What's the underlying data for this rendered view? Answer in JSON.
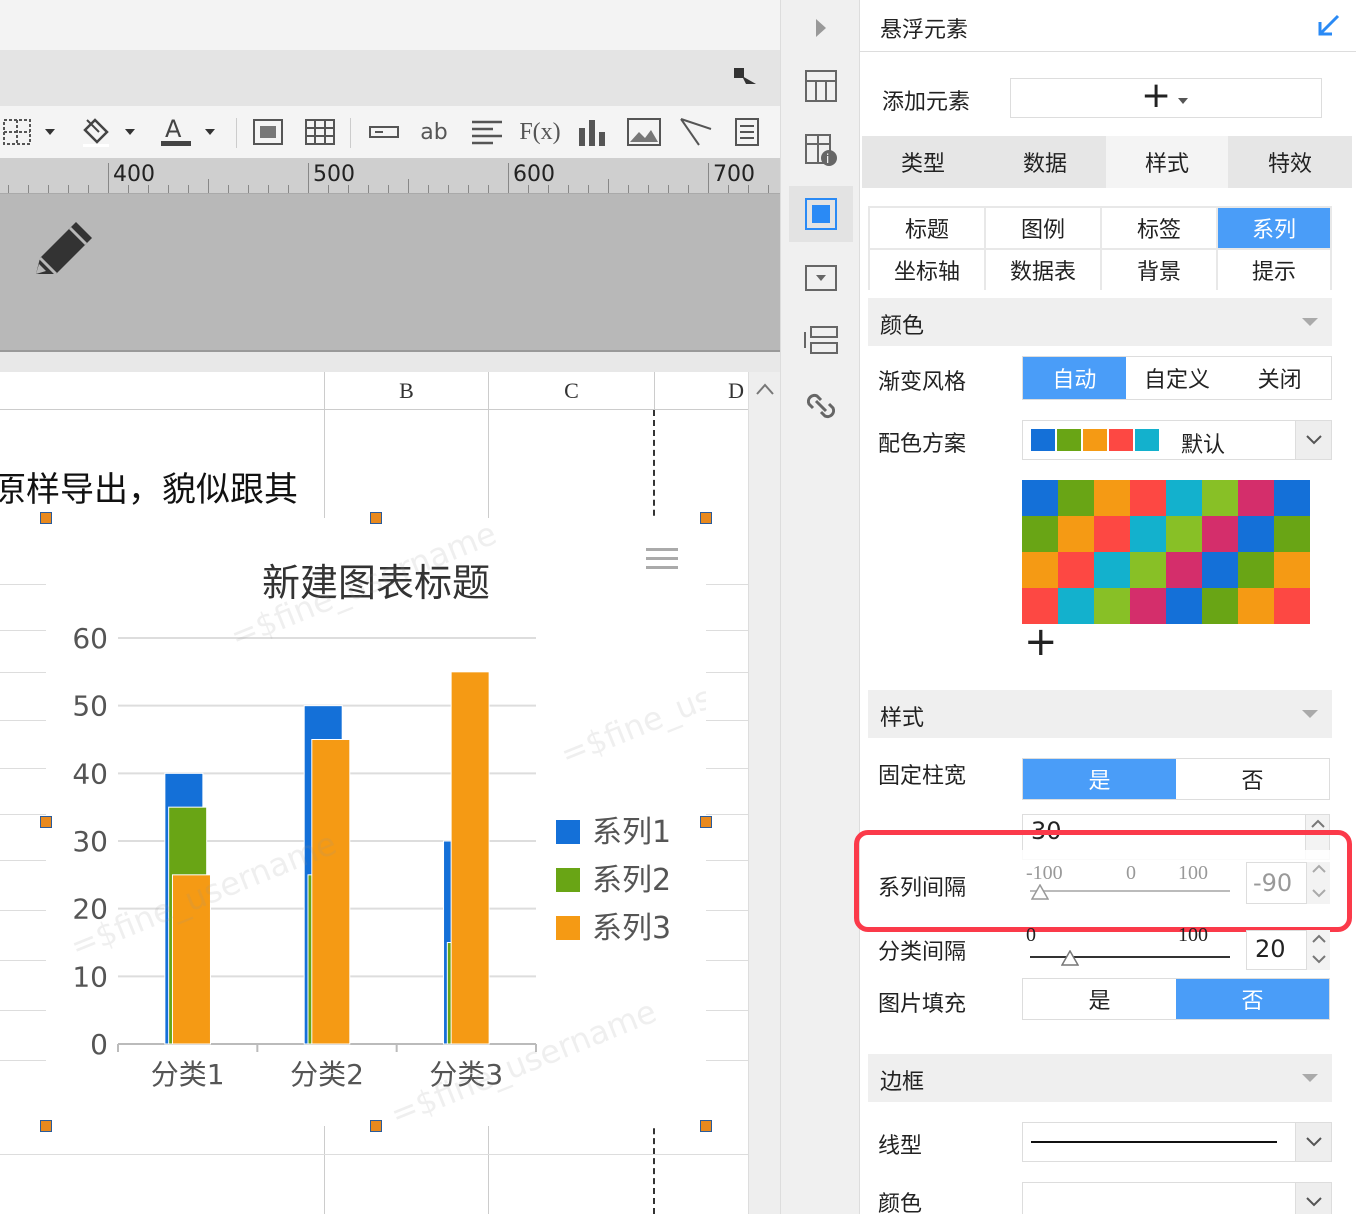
{
  "editor": {
    "toolbar_icons": [
      "border-icon",
      "paint-bucket-icon",
      "font-color-icon",
      "merge-icon",
      "table-icon",
      "textbox-icon",
      "ab-icon",
      "align-icon",
      "formula-icon",
      "bar-chart-icon",
      "image-icon",
      "slash-icon",
      "page-icon"
    ],
    "ruler": {
      "labels": [
        "400",
        "500",
        "600",
        "700"
      ]
    },
    "columns": [
      "B",
      "C",
      "D"
    ],
    "cell_text": "原样导出，貌似跟其"
  },
  "chart": {
    "chart_data": {
      "type": "bar",
      "title": "新建图表标题",
      "categories": [
        "分类1",
        "分类2",
        "分类3"
      ],
      "series": [
        {
          "name": "系列1",
          "values": [
            40,
            50,
            30
          ]
        },
        {
          "name": "系列2",
          "values": [
            35,
            25,
            15
          ]
        },
        {
          "name": "系列3",
          "values": [
            25,
            45,
            55
          ]
        }
      ],
      "ylim": [
        0,
        60
      ],
      "yticks": [
        "0",
        "10",
        "20",
        "30",
        "40",
        "50",
        "60"
      ],
      "legend": "right",
      "grid": true,
      "series_gap": -90,
      "colors": [
        "#1470d8",
        "#69a515",
        "#f59a14"
      ]
    },
    "menu_icon": "hamburger-icon",
    "watermark": "=$fine_username"
  },
  "sidebar_icons": [
    "expand-arrow-icon",
    "cell-element-icon",
    "cell-attr-icon",
    "float-element-icon",
    "widget-icon",
    "condition-icon",
    "link-icon"
  ],
  "panel": {
    "title": "悬浮元素",
    "add_label": "添加元素",
    "add_button": "+",
    "main_tabs": [
      {
        "label": "类型",
        "active": false
      },
      {
        "label": "数据",
        "active": false
      },
      {
        "label": "样式",
        "active": true
      },
      {
        "label": "特效",
        "active": false
      }
    ],
    "sub_tabs": [
      {
        "label": "标题",
        "active": false
      },
      {
        "label": "图例",
        "active": false
      },
      {
        "label": "标签",
        "active": false
      },
      {
        "label": "系列",
        "active": true
      },
      {
        "label": "坐标轴",
        "active": false
      },
      {
        "label": "数据表",
        "active": false
      },
      {
        "label": "背景",
        "active": false
      },
      {
        "label": "提示",
        "active": false
      }
    ],
    "color_section": {
      "title": "颜色",
      "gradient_label": "渐变风格",
      "gradient_options": [
        "自动",
        "自定义",
        "关闭"
      ],
      "gradient_selected": "自动",
      "scheme_label": "配色方案",
      "scheme_value": "默认",
      "scheme_swatches": [
        "#1470d8",
        "#69a515",
        "#f59a14",
        "#fd4843",
        "#13b1cd"
      ],
      "palette": [
        [
          "#1470d8",
          "#69a515",
          "#f59a14",
          "#fd4843",
          "#13b1cd",
          "#88c026",
          "#d42e6b",
          "#1470d8"
        ],
        [
          "#69a515",
          "#f59a14",
          "#fd4843",
          "#13b1cd",
          "#88c026",
          "#d42e6b",
          "#1470d8",
          "#69a515"
        ],
        [
          "#f59a14",
          "#fd4843",
          "#13b1cd",
          "#88c026",
          "#d42e6b",
          "#1470d8",
          "#69a515",
          "#f59a14"
        ],
        [
          "#fd4843",
          "#13b1cd",
          "#88c026",
          "#d42e6b",
          "#1470d8",
          "#69a515",
          "#f59a14",
          "#fd4843"
        ]
      ],
      "add_color": "+"
    },
    "style_section": {
      "title": "样式",
      "fixed_width_label": "固定柱宽",
      "fixed_width_options": [
        "是",
        "否"
      ],
      "fixed_width_selected": "是",
      "bar_width_value": "30",
      "series_gap_label": "系列间隔",
      "series_gap_min": "-100",
      "series_gap_mid": "0",
      "series_gap_max": "100",
      "series_gap_value": "-90",
      "series_gap_level": 0.05,
      "category_gap_label": "分类间隔",
      "category_gap_min": "0",
      "category_gap_max": "100",
      "category_gap_value": "20",
      "category_gap_level": 0.2,
      "image_fill_label": "图片填充",
      "image_fill_options": [
        "是",
        "否"
      ],
      "image_fill_selected": "否"
    },
    "border_section": {
      "title": "边框",
      "line_label": "线型",
      "color_label": "颜色"
    },
    "highlight_color": "#fb3a4a",
    "accent_color": "#4a9df8"
  }
}
